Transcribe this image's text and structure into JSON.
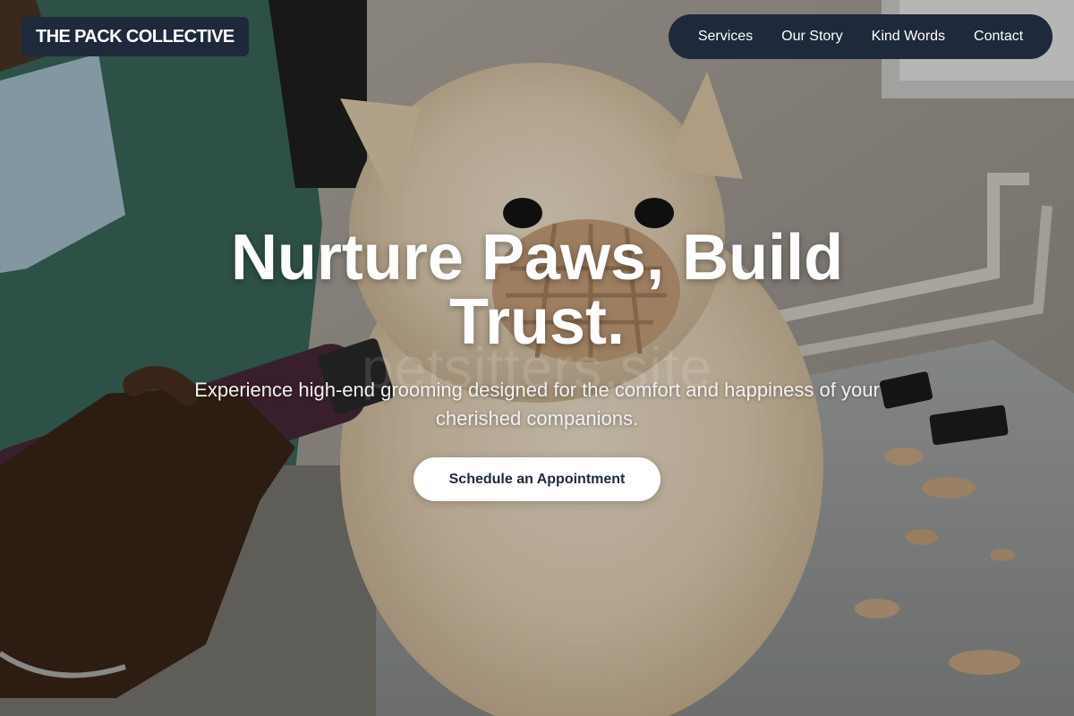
{
  "brand": {
    "name": "THE PACK COLLECTIVE"
  },
  "nav": {
    "items": [
      {
        "label": "Services"
      },
      {
        "label": "Our Story"
      },
      {
        "label": "Kind Words"
      },
      {
        "label": "Contact"
      }
    ]
  },
  "hero": {
    "title_line1": "Nurture Paws, Build",
    "title_line2": "Trust.",
    "subtitle_line1": "Experience high-end grooming designed for the comfort and happiness of your",
    "subtitle_line2": "cherished companions.",
    "cta_label": "Schedule an Appointment",
    "watermark": "petsitters.site",
    "photo_alt": "Groomer trimming a cream Pomeranian wearing a muzzle on a grooming table"
  },
  "colors": {
    "nav_bg": "#1e293b",
    "text_light": "#ffffff",
    "cta_bg": "#ffffff",
    "cta_text": "#1e293b"
  }
}
